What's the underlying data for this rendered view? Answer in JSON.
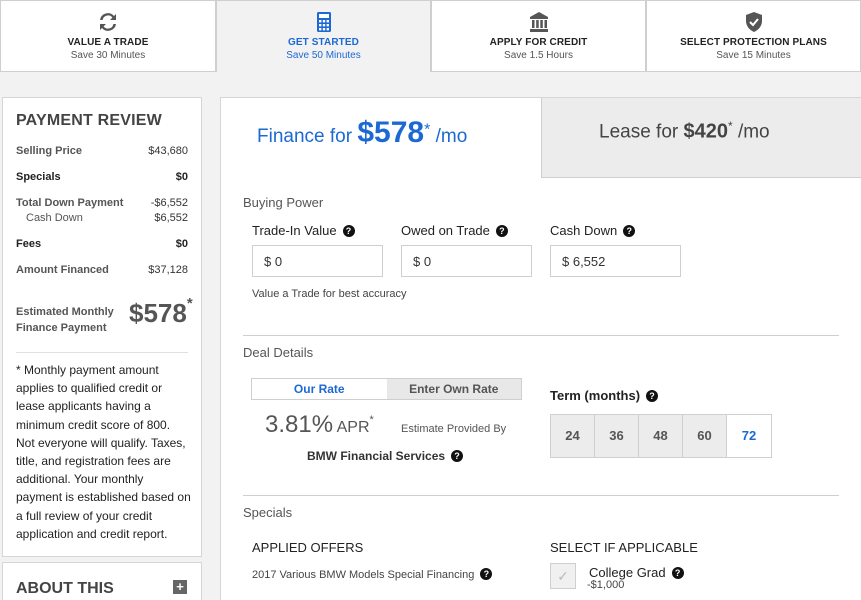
{
  "steps": [
    {
      "title": "VALUE A TRADE",
      "sub": "Save 30 Minutes",
      "icon": "refresh-icon"
    },
    {
      "title": "GET STARTED",
      "sub": "Save 50 Minutes",
      "icon": "calculator-icon"
    },
    {
      "title": "APPLY FOR CREDIT",
      "sub": "Save 1.5 Hours",
      "icon": "bank-icon"
    },
    {
      "title": "SELECT PROTECTION PLANS",
      "sub": "Save 15 Minutes",
      "icon": "shield-check-icon"
    }
  ],
  "review": {
    "title": "PAYMENT REVIEW",
    "selling_price_label": "Selling Price",
    "selling_price": "$43,680",
    "specials_label": "Specials",
    "specials": "$0",
    "total_down_label": "Total Down Payment",
    "total_down": "-$6,552",
    "cash_down_label": "Cash Down",
    "cash_down": "$6,552",
    "fees_label": "Fees",
    "fees": "$0",
    "amount_financed_label": "Amount Financed",
    "amount_financed": "$37,128",
    "est_label": "Estimated Monthly Finance Payment",
    "est_value": "$578",
    "asterisk": "*",
    "disclaimer": "* Monthly payment amount applies to qualified credit or lease applicants having a minimum credit score of 800.  Not everyone will qualify. Taxes, title, and registration fees are additional. Your monthly payment is established based on a full review of your credit application and credit report."
  },
  "about": {
    "title": "ABOUT THIS",
    "plus": "+"
  },
  "finance_tab": {
    "prefix": "Finance for ",
    "amount": "$578",
    "asterisk": "*",
    "suffix": " /mo"
  },
  "lease_tab": {
    "prefix": "Lease for ",
    "amount": "$420",
    "asterisk": "*",
    "suffix": " /mo"
  },
  "buying_power": {
    "title": "Buying Power",
    "trade_in_label": "Trade-In Value",
    "trade_in_value": "$ 0",
    "owed_label": "Owed on Trade",
    "owed_value": "$ 0",
    "cash_down_label": "Cash Down",
    "cash_down_value": "$ 6,552",
    "hint_link": "Value a Trade",
    "hint_rest": " for best accuracy",
    "help": "?"
  },
  "deal": {
    "title": "Deal Details",
    "our_rate": "Our Rate",
    "own_rate": "Enter Own Rate",
    "apr_value": "3.81%",
    "apr_unit": " APR",
    "asterisk": "*",
    "estimate_by": "Estimate Provided By",
    "provider": "BMW Financial Services",
    "term_label": "Term (months)",
    "terms": [
      "24",
      "36",
      "48",
      "60",
      "72"
    ],
    "selected_term": "72"
  },
  "specials": {
    "title": "Specials",
    "applied_head": "APPLIED OFFERS",
    "select_head": "SELECT IF APPLICABLE",
    "offer": "2017 Various BMW Models Special Financing",
    "college": "College Grad",
    "college_amt": "-$1,000"
  }
}
